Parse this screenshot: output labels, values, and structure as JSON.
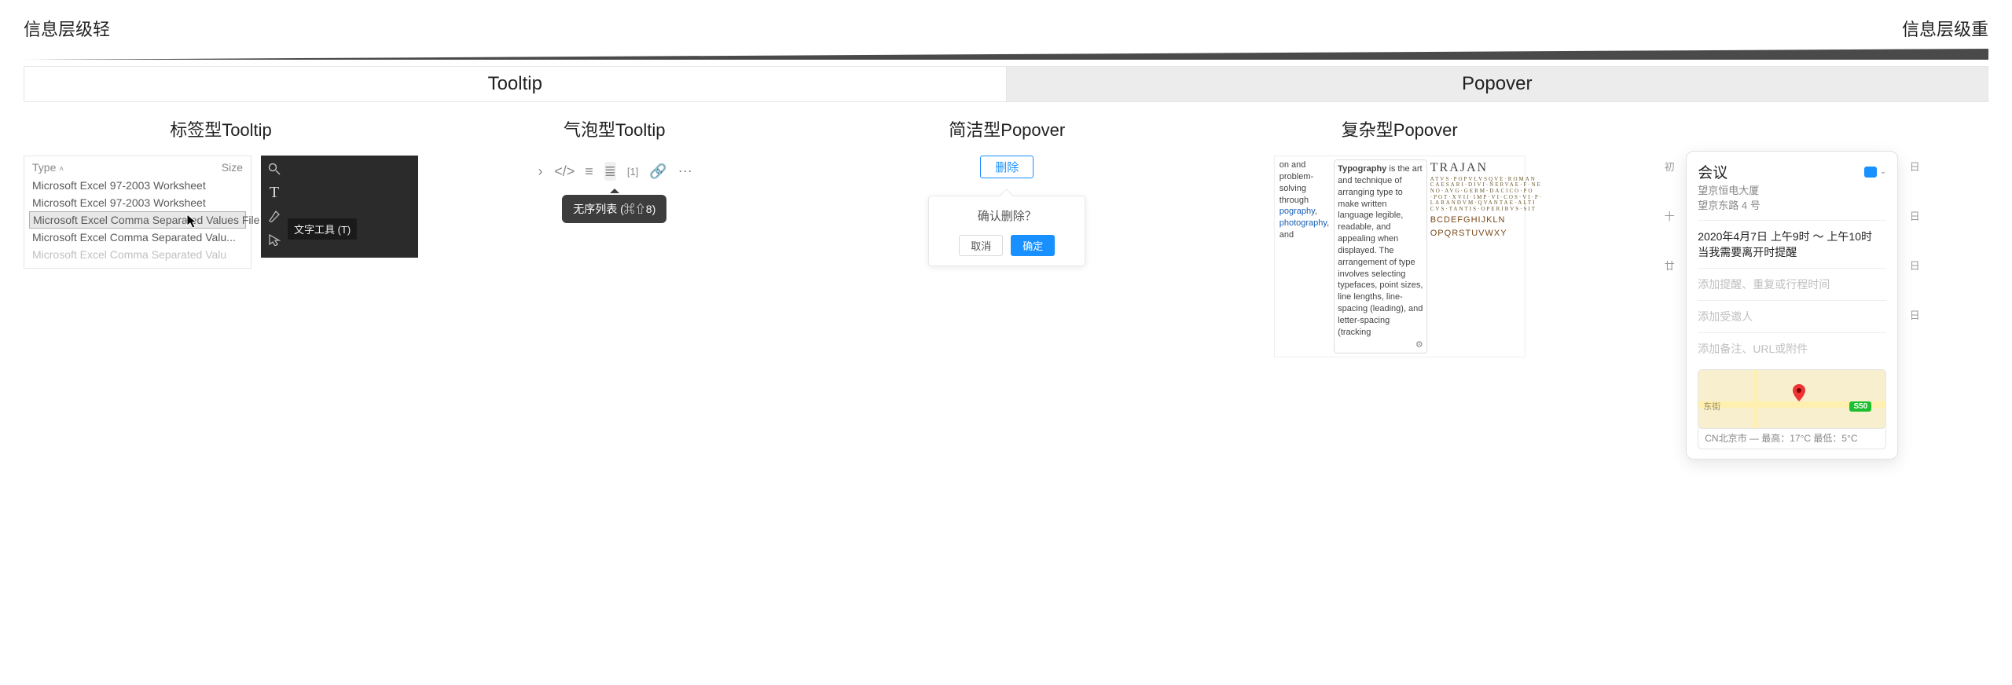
{
  "scale": {
    "left": "信息层级轻",
    "right": "信息层级重"
  },
  "tabs": {
    "tooltip": "Tooltip",
    "popover": "Popover"
  },
  "cols": {
    "label_tooltip": "标签型Tooltip",
    "bubble_tooltip": "气泡型Tooltip",
    "simple_popover": "简洁型Popover",
    "complex_popover": "复杂型Popover"
  },
  "explorer": {
    "head_type": "Type",
    "head_size": "Size",
    "rows": [
      "Microsoft Excel 97-2003 Worksheet",
      "Microsoft Excel 97-2003 Worksheet",
      "Microsoft Excel Comma Separated Values File",
      "Microsoft Excel Comma Separated Valu...",
      "Microsoft Excel Comma Separated Valu"
    ]
  },
  "toolbox_tip": "文字工具 (T)",
  "bubble": {
    "label": "无序列表",
    "shortcut": "(⌘⇧8)"
  },
  "pop_delete": {
    "trigger": "删除",
    "question": "确认删除？",
    "cancel": "取消",
    "ok": "确定"
  },
  "wiki": {
    "pre_text": "on and problem-solving through",
    "links": [
      "pography",
      "photography"
    ],
    "bold": "Typography",
    "body": " is the art and technique of arranging type to make written language legible, readable, and appealing when displayed. The arrangement of type involves selecting typefaces, point sizes, line lengths, line-spacing (leading), and letter-spacing (tracking",
    "trajan_title": "TRAJAN",
    "trajan_lines": [
      "ATVS·POPVLVSQVE·ROMAN",
      "CAESARI·DIVI·NERVAE·F·NE",
      "NO·AVG·GERM·DACICO·PO",
      "·POT·XVII·IMP·VI·COS·VI·P·",
      "LARANDVM·QVANTAE·ALTI",
      "CVS·TANTIS·OPERIBVS·SIT"
    ],
    "abc1": "BCDEFGHIJKLN",
    "abc2": "OPQRSTUVWXY"
  },
  "calendar": {
    "left_markers": [
      "初",
      "日",
      "日",
      "十",
      "日",
      "廿",
      "日"
    ],
    "title": "会议",
    "place1": "望京恒电大厦",
    "place2": "望京东路 4 号",
    "time": "2020年4月7日  上午9时 ～ 上午10时",
    "alert": "当我需要离开时提醒",
    "ph_reminder": "添加提醒、重复或行程时间",
    "ph_invitee": "添加受邀人",
    "ph_notes": "添加备注、URL或附件",
    "map_road_label": "东街",
    "map_shield": "S50",
    "weather": "CN北京市 — 最高：17°C 最低：5°C"
  }
}
